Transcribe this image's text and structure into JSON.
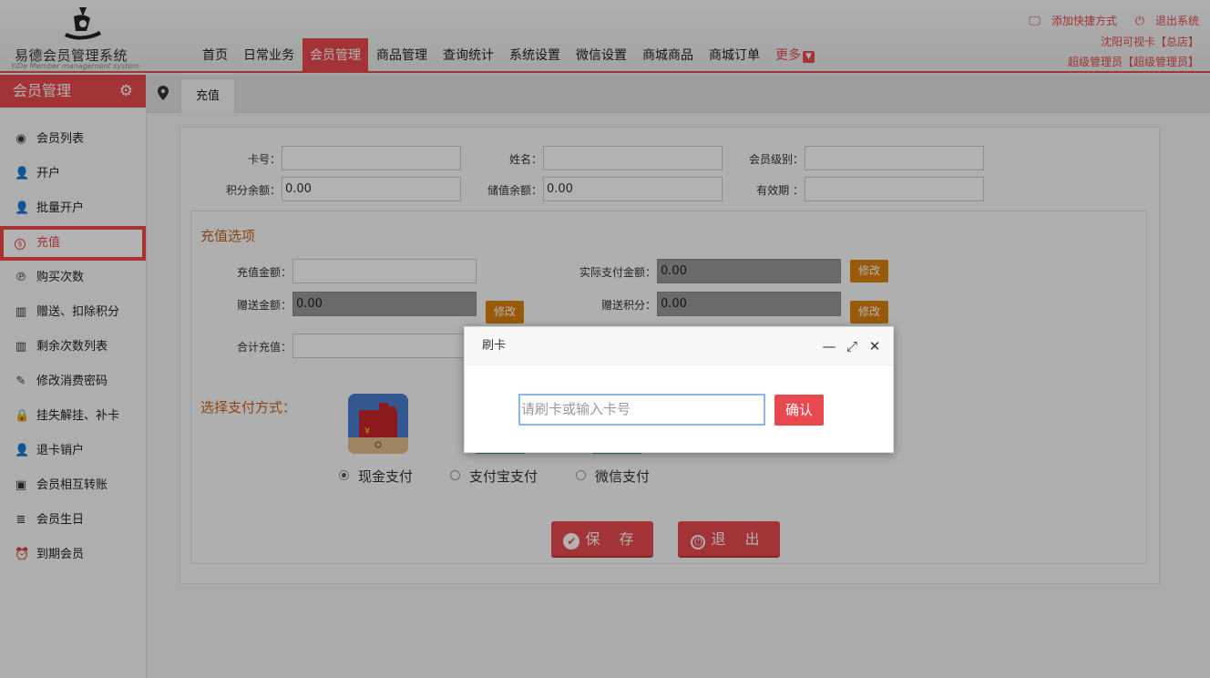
{
  "app": {
    "title": "易德会员管理系统",
    "subtitle": "YiDe Member management system"
  },
  "nav": {
    "items": [
      "首页",
      "日常业务",
      "会员管理",
      "商品管理",
      "查询统计",
      "系统设置",
      "微信设置",
      "商城商品",
      "商城订单"
    ],
    "active_index": 2,
    "more_label": "更多"
  },
  "topright": {
    "shortcut_label": "添加快捷方式",
    "logout_label": "退出系统",
    "store": "沈阳可视卡【总店】",
    "user": "超级管理员【超级管理员】"
  },
  "sidebar": {
    "title": "会员管理",
    "items": [
      {
        "label": "会员列表",
        "icon": "user-circle-icon"
      },
      {
        "label": "开户",
        "icon": "user-icon"
      },
      {
        "label": "批量开户",
        "icon": "user-icon"
      },
      {
        "label": "充值",
        "icon": "dollar-circle-icon"
      },
      {
        "label": "购买次数",
        "icon": "paypal-icon"
      },
      {
        "label": "赠送、扣除积分",
        "icon": "map-icon"
      },
      {
        "label": "剩余次数列表",
        "icon": "map-icon"
      },
      {
        "label": "修改消费密码",
        "icon": "pencil-icon"
      },
      {
        "label": "挂失解挂、补卡",
        "icon": "lock-icon"
      },
      {
        "label": "退卡销户",
        "icon": "user-icon"
      },
      {
        "label": "会员相互转账",
        "icon": "image-icon"
      },
      {
        "label": "会员生日",
        "icon": "cake-icon"
      },
      {
        "label": "到期会员",
        "icon": "alarm-clock-icon"
      }
    ],
    "active_index": 3
  },
  "breadcrumb": {
    "current": "充值"
  },
  "member_info": {
    "card_no_label": "卡号：",
    "card_no": "",
    "name_label": "姓名：",
    "name": "",
    "level_label": "会员级别：",
    "level": "",
    "points_label": "积分余额：",
    "points": "0.00",
    "stored_label": "储值余额：",
    "stored": "0.00",
    "expiry_label": "有效期 ：",
    "expiry": ""
  },
  "recharge": {
    "section_title": "充值选项",
    "amount_label": "充值金额：",
    "amount": "",
    "actual_label": "实际支付金额：",
    "actual": "0.00",
    "gift_amount_label": "赠送金额：",
    "gift_amount": "0.00",
    "gift_points_label": "赠送积分：",
    "gift_points": "0.00",
    "total_label": "合计充值：",
    "total": "",
    "edit_label": "修改"
  },
  "payment": {
    "title": "选择支付方式：",
    "options": [
      "现金支付",
      "支付宝支付",
      "微信支付"
    ],
    "selected_index": 0
  },
  "actions": {
    "save_label": "保 存",
    "exit_label": "退 出"
  },
  "dialog": {
    "title": "刷卡",
    "input_placeholder": "请刷卡或输入卡号",
    "confirm_label": "确认"
  },
  "colors": {
    "accent": "#e8494f",
    "orange": "#dc8310",
    "section_title": "#c8641a"
  }
}
